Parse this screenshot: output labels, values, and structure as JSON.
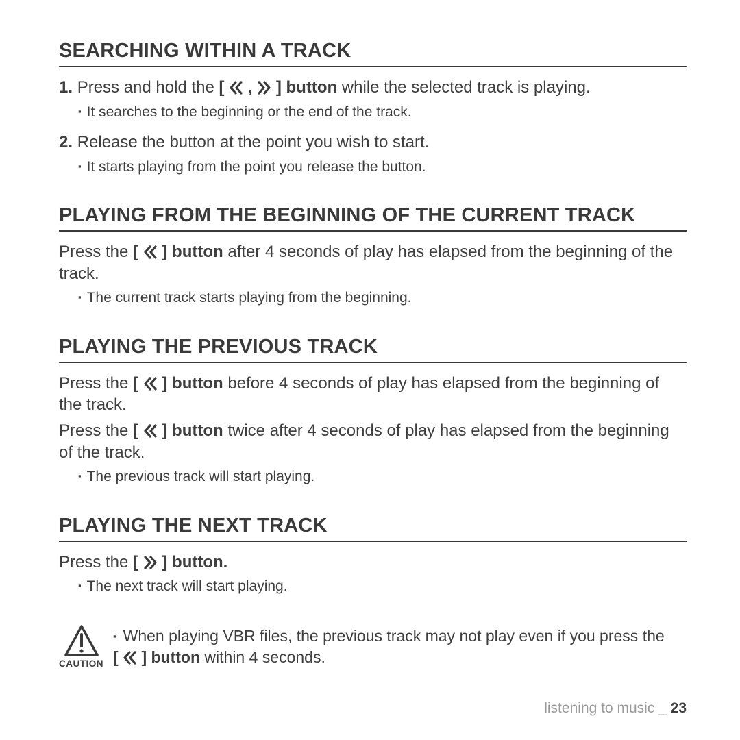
{
  "icons": {
    "rew": "«",
    "fwd": "»"
  },
  "sections": [
    {
      "title": "SEARCHING WITHIN A TRACK",
      "steps": [
        {
          "num": "1.",
          "pre": "Press and hold the ",
          "btn": "[ « , » ] button",
          "post": " while the selected track is playing.",
          "bullet": "It searches to the beginning or the end of the track."
        },
        {
          "num": "2.",
          "pre": "Release the button at the point you wish to start.",
          "btn": "",
          "post": "",
          "bullet": "It starts playing from the point you release the button."
        }
      ]
    },
    {
      "title": "PLAYING FROM THE BEGINNING OF THE CURRENT TRACK",
      "paras": [
        {
          "pre": "Press the ",
          "btn": "[ « ] button",
          "post": " after 4 seconds of play has elapsed from the beginning of the track."
        }
      ],
      "bullet": "The current track starts playing from the beginning."
    },
    {
      "title": "PLAYING THE PREVIOUS TRACK",
      "paras": [
        {
          "pre": "Press the ",
          "btn": "[ « ] button",
          "post": " before 4 seconds of play has elapsed from the beginning of the track."
        },
        {
          "pre": "Press the ",
          "btn": "[ « ] button",
          "post": " twice after 4 seconds of play has elapsed from the beginning of the track."
        }
      ],
      "bullet": "The previous track will start playing."
    },
    {
      "title": "PLAYING THE NEXT TRACK",
      "paras": [
        {
          "pre": "Press the ",
          "btn": "[ » ] button.",
          "post": ""
        }
      ],
      "bullet": "The next track will start playing."
    }
  ],
  "caution": {
    "label": "CAUTION",
    "pre": "When playing VBR files, the previous track may not play even if you press the ",
    "btn": "[ « ] button",
    "post": " within 4 seconds."
  },
  "footer": {
    "text": "listening to music _ ",
    "page": "23"
  }
}
